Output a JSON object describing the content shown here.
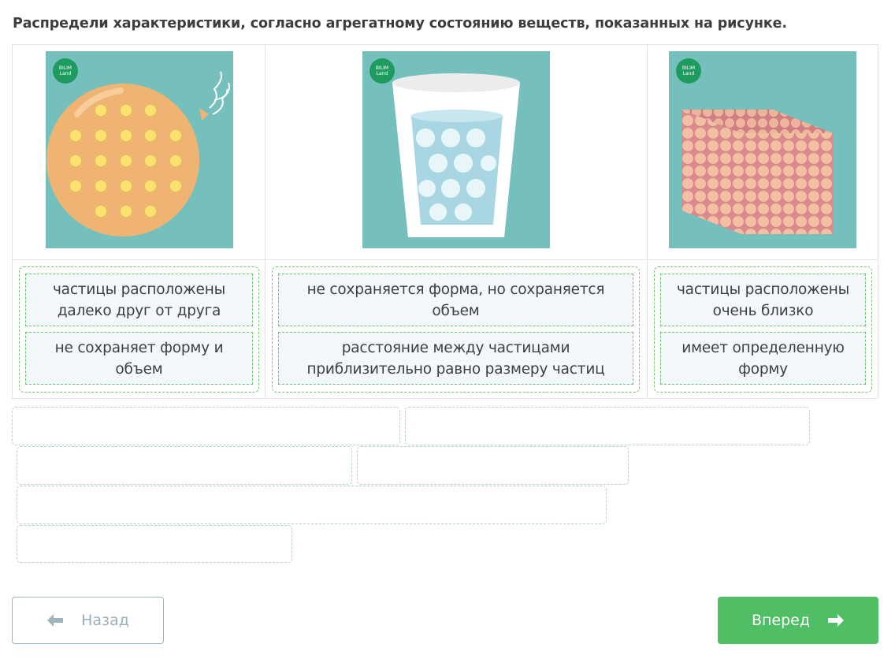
{
  "task": {
    "title": "Распредели характеристики, согласно агрегатному состоянию веществ, показанных на рисунке."
  },
  "columns": [
    {
      "image_icon": "balloon-gas-image",
      "logo_text": "BILIM Land",
      "cards": [
        "частицы расположены далеко друг от друга",
        "не сохраняет форму и объем"
      ]
    },
    {
      "image_icon": "glass-of-water-liquid-image",
      "logo_text": "BILIM Land",
      "cards": [
        "не сохраняется форма, но сохраняется объем",
        "расстояние между частицами приблизительно равно размеру частиц"
      ]
    },
    {
      "image_icon": "cube-solid-image",
      "logo_text": "BILIM Land",
      "cards": [
        "частицы расположены очень близко",
        "имеет определенную форму"
      ]
    }
  ],
  "answer_pool": {
    "empty_slots": 6
  },
  "nav": {
    "back_label": "Назад",
    "back_icon": "arrow-left-icon",
    "next_label": "Вперед",
    "next_icon": "arrow-right-icon"
  },
  "colors": {
    "accent_green": "#4fbe65",
    "image_bg": "#75c0bd",
    "card_bg": "#f3f8fb"
  }
}
